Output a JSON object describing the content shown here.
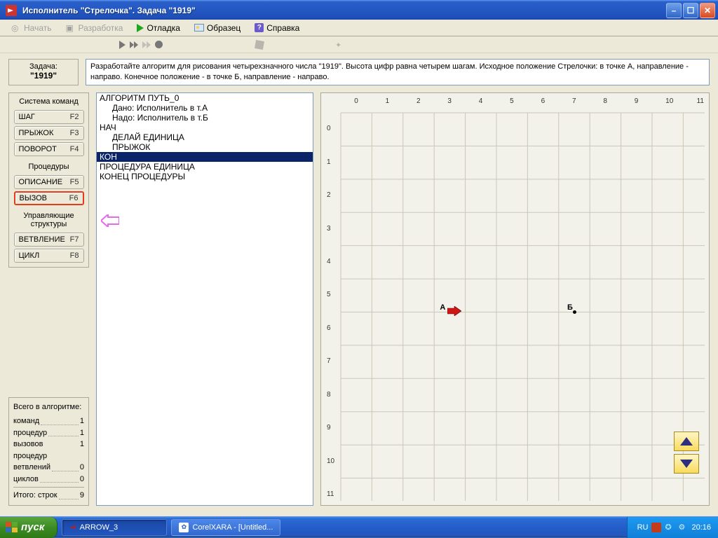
{
  "window": {
    "title": "Исполнитель \"Стрелочка\".  Задача  \"1919\""
  },
  "menu": {
    "start": "Начать",
    "develop": "Разработка",
    "debug": "Отладка",
    "sample": "Образец",
    "help": "Справка"
  },
  "task": {
    "label": "Задача:",
    "name": "\"1919\"",
    "description": "Разработайте алгоритм для рисования четырехзначного числа \"1919\". Высота цифр равна четырем шагам. Исходное положение Стрелочки: в точке А, направление - направо. Конечное положение - в  точке Б, направление - направо."
  },
  "commands": {
    "title1": "Система команд",
    "shag": "ШАГ",
    "shag_k": "F2",
    "pryzhok": "ПРЫЖОК",
    "pryzhok_k": "F3",
    "povorot": "ПОВОРОТ",
    "povorot_k": "F4",
    "title2": "Процедуры",
    "opis": "ОПИСАНИЕ",
    "opis_k": "F5",
    "vyzov": "ВЫЗОВ",
    "vyzov_k": "F6",
    "title3": "Управляющие структуры",
    "vetv": "ВЕТВЛЕНИЕ",
    "vetv_k": "F7",
    "cikl": "ЦИКЛ",
    "cikl_k": "F8"
  },
  "code": {
    "l1": "АЛГОРИТМ ПУТЬ_0",
    "l2": "Дано: Исполнитель в т.А",
    "l3": "Надо: Исполнитель в т.Б",
    "l4": "НАЧ",
    "l5": "ДЕЛАЙ ЕДИНИЦА",
    "l6": "ПРЫЖОК",
    "l7": "КОН",
    "l8": "ПРОЦЕДУРА ЕДИНИЦА",
    "l9": "КОНЕЦ ПРОЦЕДУРЫ"
  },
  "grid": {
    "cols": [
      "0",
      "1",
      "2",
      "3",
      "4",
      "5",
      "6",
      "7",
      "8",
      "9",
      "10",
      "11"
    ],
    "rows": [
      "0",
      "1",
      "2",
      "3",
      "4",
      "5",
      "6",
      "7",
      "8",
      "9",
      "10",
      "11"
    ],
    "pointA": "А",
    "pointB": "Б"
  },
  "stats": {
    "title": "Всего в алгоритме:",
    "commands": "команд",
    "commands_v": "1",
    "procs": "процедур",
    "procs_v": "1",
    "calls": "вызовов процедур",
    "calls_v": "1",
    "branches": "ветвлений",
    "branches_v": "0",
    "loops": "циклов",
    "loops_v": "0",
    "total": "Итого:  строк",
    "total_v": "9"
  },
  "taskbar": {
    "start": "пуск",
    "app1": "ARROW_3",
    "app2": "CorelXARA - [Untitled...",
    "lang": "RU",
    "time": "20:16"
  }
}
